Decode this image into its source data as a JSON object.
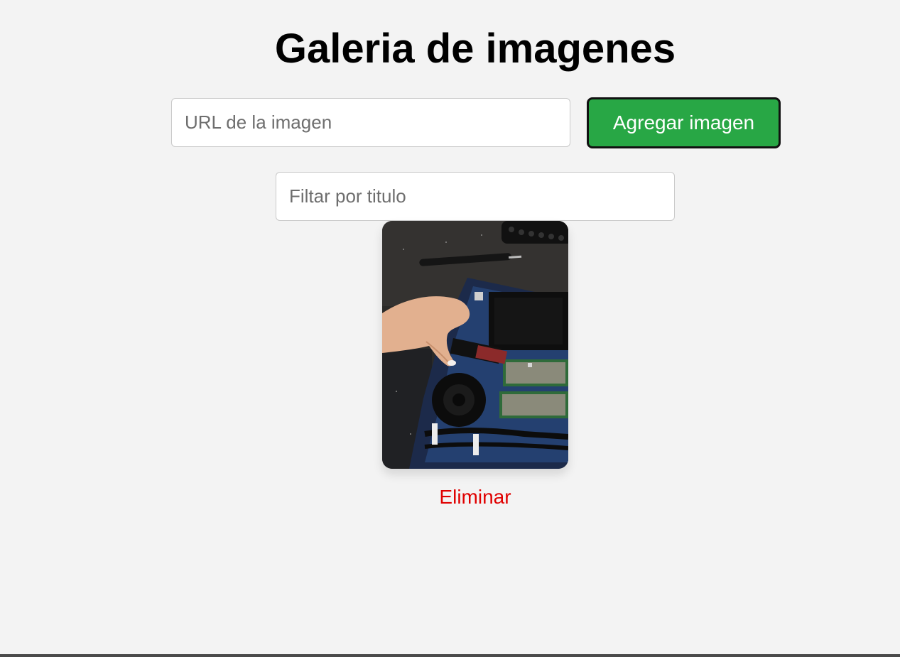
{
  "header": {
    "title": "Galeria de imagenes"
  },
  "form": {
    "url_placeholder": "URL de la imagen",
    "add_button_label": "Agregar imagen"
  },
  "filter": {
    "placeholder": "Filtar por titulo"
  },
  "gallery": {
    "items": [
      {
        "delete_label": "Eliminar"
      }
    ]
  },
  "colors": {
    "add_button": "#28a745",
    "delete_link": "#e00000",
    "background": "#f3f3f3"
  }
}
